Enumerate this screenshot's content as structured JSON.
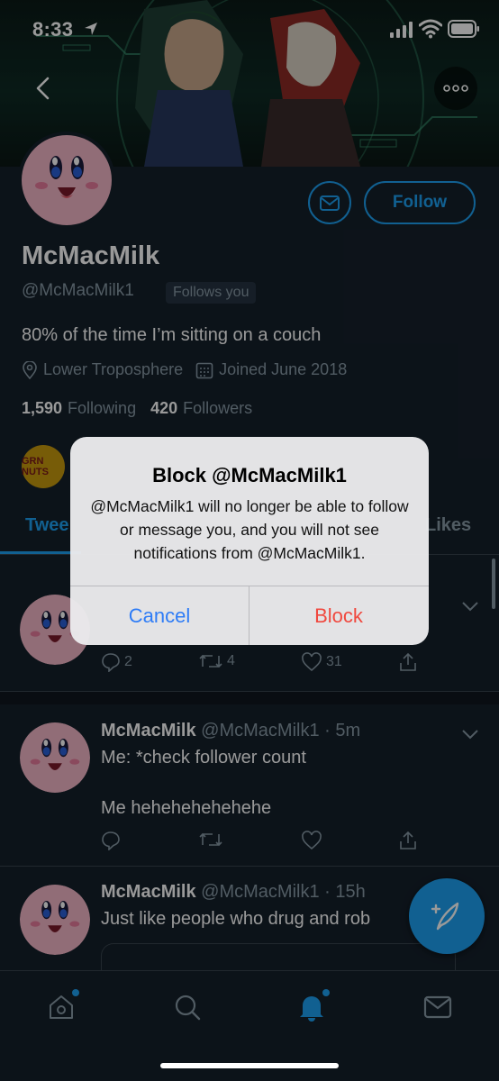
{
  "status_bar": {
    "time": "8:33"
  },
  "profile": {
    "display_name": "McMacMilk",
    "handle": "@McMacMilk1",
    "follows_you": "Follows you",
    "bio": "80% of the time I’m sitting on a couch",
    "location": "Lower Troposphere",
    "joined": "Joined June 2018",
    "following_count": "1,590",
    "following_label": "Following",
    "followers_count": "420",
    "followers_label": "Followers",
    "follow_label": "Follow",
    "badge_text": "GRN NUTS"
  },
  "tabs": [
    {
      "label": "Twee"
    },
    {
      "label": "Likes"
    }
  ],
  "tweets": [
    {
      "name": "",
      "handle": "",
      "text": "",
      "replies": "2",
      "retweets": "4",
      "likes": "31"
    },
    {
      "name": "McMacMilk",
      "handle": "@McMacMilk1 · 5m",
      "text": "Me: *check follower count\n\nMe hehehehehehehe",
      "replies": "",
      "retweets": "",
      "likes": ""
    },
    {
      "name": "McMacMilk",
      "handle": "@McMacMilk1 · 15h",
      "text": "Just like people who drug and rob",
      "replies": "",
      "retweets": "",
      "likes": ""
    }
  ],
  "alert": {
    "title": "Block @McMacMilk1",
    "message": "@McMacMilk1 will no longer be able to follow or message you, and you will not see notifications from @McMacMilk1.",
    "cancel_label": "Cancel",
    "block_label": "Block"
  },
  "colors": {
    "accent": "#1da1f2",
    "background": "#15202b",
    "secondary_text": "#8899a6",
    "alert_cancel": "#2e7cf6",
    "alert_destructive": "#f0483e"
  },
  "icons": [
    "location-arrow-icon",
    "signal-icon",
    "wifi-icon",
    "battery-icon",
    "back-chevron-icon",
    "more-icon",
    "mail-icon",
    "location-pin-icon",
    "calendar-icon",
    "reply-icon",
    "retweet-icon",
    "like-icon",
    "share-icon",
    "chevron-down-icon",
    "compose-icon",
    "home-icon",
    "search-icon",
    "notifications-icon",
    "messages-icon"
  ]
}
